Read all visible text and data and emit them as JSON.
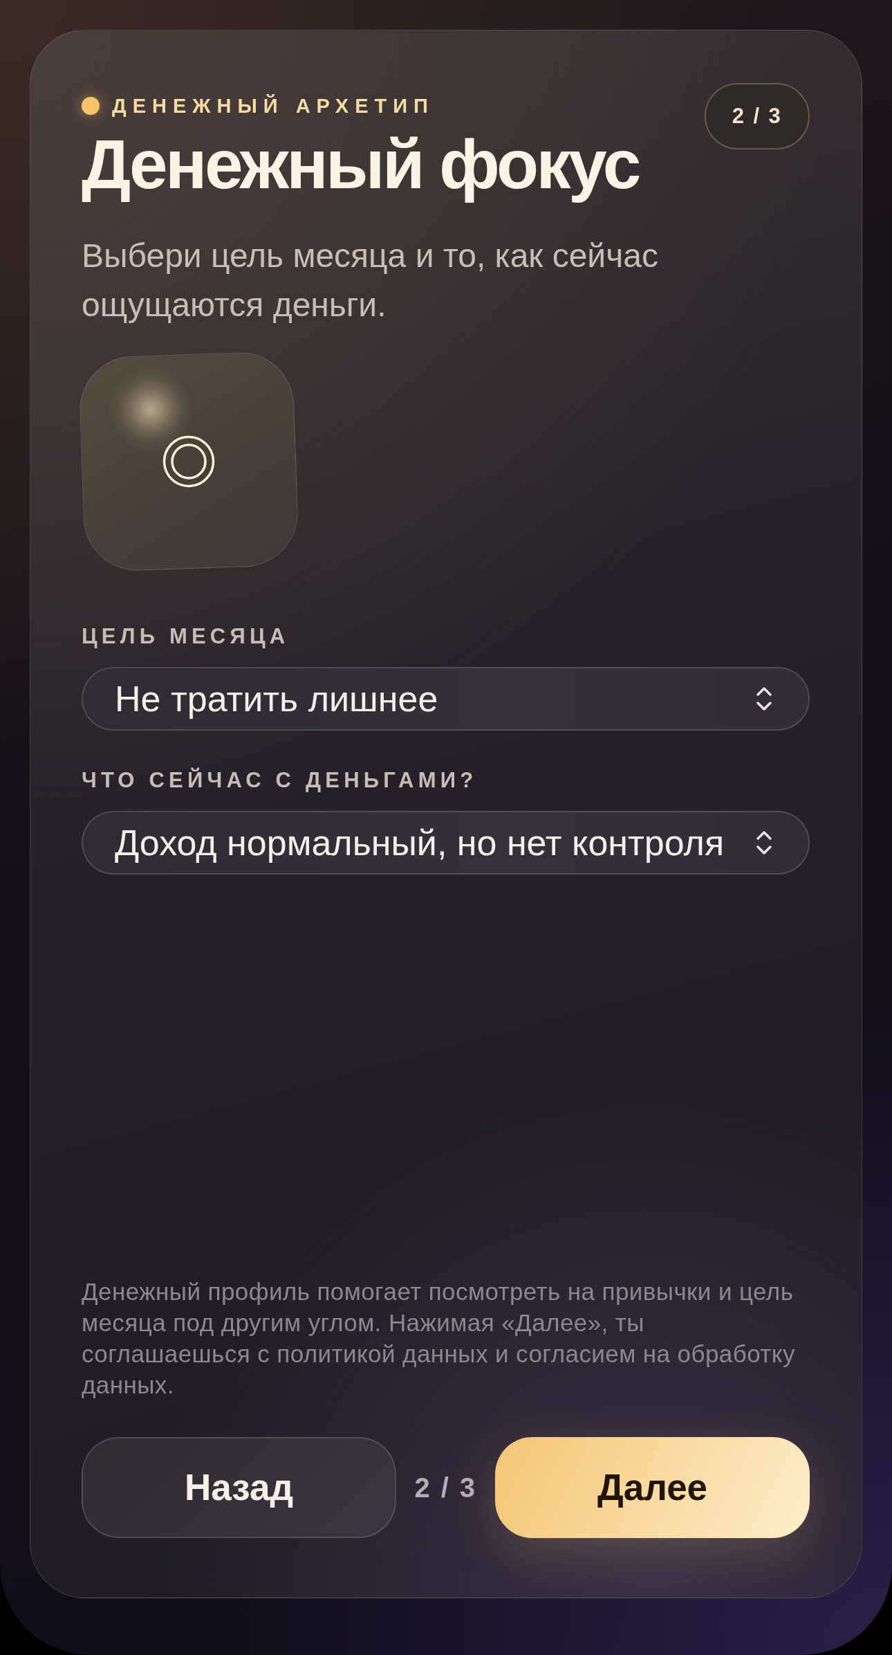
{
  "header": {
    "eyebrow": "ДЕНЕЖНЫЙ АРХЕТИП",
    "step_badge": "2 / 3",
    "title": "Денежный фокус",
    "subtitle": "Выбери цель месяца и то, как сейчас ощущаются деньги."
  },
  "fields": [
    {
      "label": "ЦЕЛЬ МЕСЯЦА",
      "value": "Не тратить лишнее"
    },
    {
      "label": "ЧТО СЕЙЧАС С ДЕНЬГАМИ?",
      "value": "Доход нормальный, но нет контроля"
    }
  ],
  "disclaimer": "Денежный профиль помогает посмотреть на привычки и цель месяца под другим углом. Нажимая «Далее», ты соглашаешься с политикой данных и согласием на обработку данных.",
  "footer": {
    "back_button": "Назад",
    "step": "2 / 3",
    "next_button": "Далее"
  }
}
